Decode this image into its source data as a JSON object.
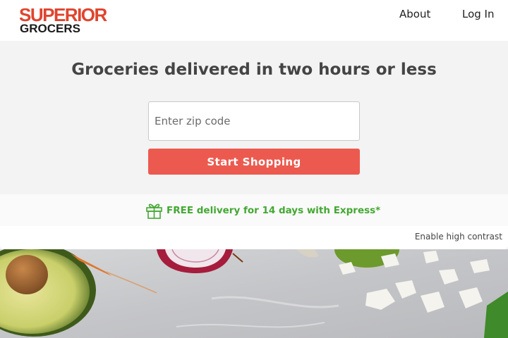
{
  "brand": {
    "logo_line1": "SUPERIOR",
    "logo_line2": "GROCERS",
    "brand_red": "#e0442e"
  },
  "nav": {
    "about_label": "About",
    "login_label": "Log In"
  },
  "hero": {
    "headline": "Groceries delivered in two hours or less",
    "zip_placeholder": "Enter zip code",
    "cta_label": "Start Shopping",
    "cta_color": "#ec5a4f"
  },
  "promo": {
    "text": "FREE delivery for 14 days with Express*",
    "icon": "gift-icon",
    "color": "#43a832"
  },
  "accessibility": {
    "contrast_label": "Enable high contrast"
  }
}
